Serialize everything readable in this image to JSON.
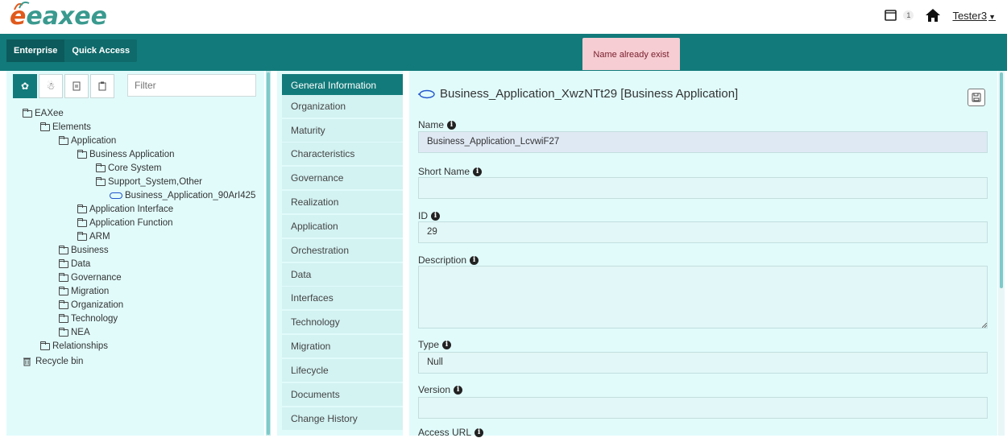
{
  "app": {
    "logo_text_a": "eaxee",
    "logo_alt": "EAXEE"
  },
  "header": {
    "notification_count": "1",
    "user_name": "Tester3"
  },
  "nav": {
    "items": [
      {
        "label": "Enterprise"
      },
      {
        "label": "Quick Access"
      }
    ]
  },
  "toast": {
    "message": "Name already exist"
  },
  "left_panel": {
    "filter_placeholder": "Filter",
    "tree": [
      {
        "label": "EAXee",
        "level": 0,
        "icon": "folder-icon"
      },
      {
        "label": "Elements",
        "level": 1,
        "icon": "folder-icon"
      },
      {
        "label": "Application",
        "level": 2,
        "icon": "folder-icon"
      },
      {
        "label": "Business Application",
        "level": 3,
        "icon": "folder-icon"
      },
      {
        "label": "Core System",
        "level": 4,
        "icon": "folder-icon"
      },
      {
        "label": "Support_System,Other",
        "level": 4,
        "icon": "folder-icon"
      },
      {
        "label": "Business_Application_90ArI425",
        "level": 5,
        "icon": "business-application-icon"
      },
      {
        "label": "Application Interface",
        "level": 3,
        "icon": "folder-icon"
      },
      {
        "label": "Application Function",
        "level": 3,
        "icon": "folder-icon"
      },
      {
        "label": "ARM",
        "level": 3,
        "icon": "folder-icon"
      },
      {
        "label": "Business",
        "level": 2,
        "icon": "folder-icon"
      },
      {
        "label": "Data",
        "level": 2,
        "icon": "folder-icon"
      },
      {
        "label": "Governance",
        "level": 2,
        "icon": "folder-icon"
      },
      {
        "label": "Migration",
        "level": 2,
        "icon": "folder-icon"
      },
      {
        "label": "Organization",
        "level": 2,
        "icon": "folder-icon"
      },
      {
        "label": "Technology",
        "level": 2,
        "icon": "folder-icon"
      },
      {
        "label": "NEA",
        "level": 2,
        "icon": "folder-icon"
      },
      {
        "label": "Relationships",
        "level": 1,
        "icon": "folder-icon"
      },
      {
        "label": "Recycle bin",
        "level": 0,
        "icon": "trash-icon"
      }
    ]
  },
  "middle_menu": {
    "items": [
      {
        "label": "General Information",
        "active": true
      },
      {
        "label": "Organization"
      },
      {
        "label": "Maturity"
      },
      {
        "label": "Characteristics"
      },
      {
        "label": "Governance"
      },
      {
        "label": "Realization"
      },
      {
        "label": "Application"
      },
      {
        "label": "Orchestration"
      },
      {
        "label": "Data"
      },
      {
        "label": "Interfaces"
      },
      {
        "label": "Technology"
      },
      {
        "label": "Migration"
      },
      {
        "label": "Lifecycle"
      },
      {
        "label": "Documents"
      },
      {
        "label": "Change History"
      }
    ]
  },
  "main": {
    "title": "Business_Application_XwzNTt29 [Business Application]",
    "fields": {
      "name": {
        "label": "Name",
        "value": "Business_Application_LcvwiF27"
      },
      "short_name": {
        "label": "Short Name",
        "value": ""
      },
      "id": {
        "label": "ID",
        "value": "29"
      },
      "description": {
        "label": "Description",
        "value": ""
      },
      "type": {
        "label": "Type",
        "value": "Null"
      },
      "version": {
        "label": "Version",
        "value": ""
      },
      "access_url": {
        "label": "Access URL"
      }
    }
  },
  "colors": {
    "primary": "#127a7a",
    "panel_bg": "#e1fbfb",
    "toast_bg": "#f6cdd2"
  }
}
